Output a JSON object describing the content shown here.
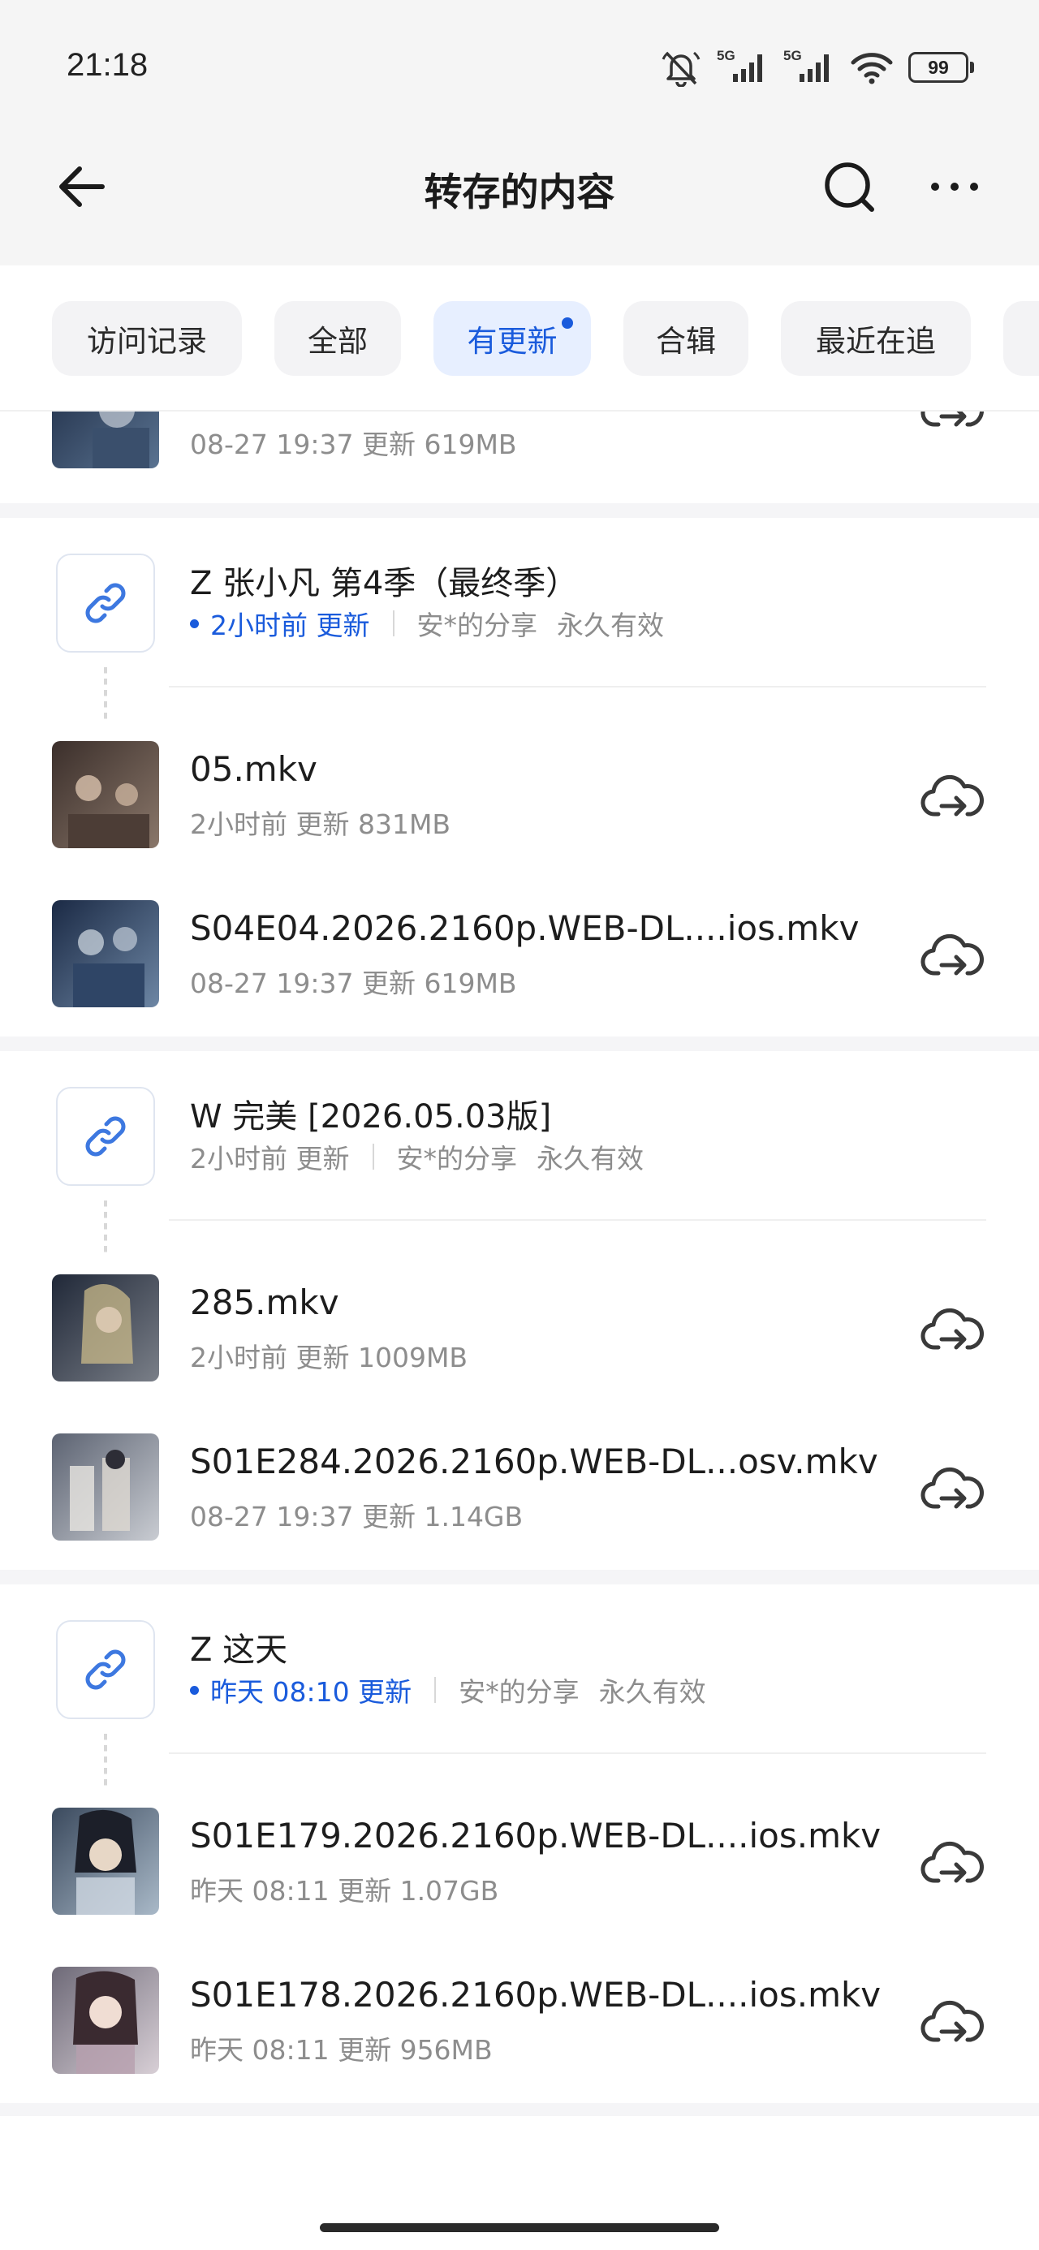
{
  "status_bar": {
    "time": "21:18",
    "net1": "5G",
    "net2": "5G",
    "battery": "99"
  },
  "nav": {
    "title": "转存的内容"
  },
  "tabs": [
    {
      "label": "访问记录",
      "active": false
    },
    {
      "label": "全部",
      "active": false
    },
    {
      "label": "有更新",
      "active": true,
      "dot": true
    },
    {
      "label": "合辑",
      "active": false
    },
    {
      "label": "最近在追",
      "active": false
    }
  ],
  "partial_row": {
    "meta": "08-27 19:37 更新 619MB"
  },
  "groups": [
    {
      "title": "Z  张小凡 第4季（最终季）",
      "update": "2小时前 更新",
      "update_highlight": true,
      "sharer": "安*的分享",
      "validity": "永久有效",
      "files": [
        {
          "name": "05.mkv",
          "meta": "2小时前 更新 831MB"
        },
        {
          "name": "S04E04.2026.2160p.WEB-DL....ios.mkv",
          "meta": "08-27 19:37 更新 619MB"
        }
      ]
    },
    {
      "title": "W 完美 [2026.05.03版]",
      "update": "2小时前 更新",
      "update_highlight": false,
      "sharer": "安*的分享",
      "validity": "永久有效",
      "files": [
        {
          "name": "285.mkv",
          "meta": "2小时前 更新 1009MB"
        },
        {
          "name": "S01E284.2026.2160p.WEB-DL...osv.mkv",
          "meta": "08-27 19:37 更新 1.14GB"
        }
      ]
    },
    {
      "title": "Z 这天",
      "update": "昨天 08:10 更新",
      "update_highlight": true,
      "sharer": "安*的分享",
      "validity": "永久有效",
      "files": [
        {
          "name": "S01E179.2026.2160p.WEB-DL....ios.mkv",
          "meta": "昨天 08:11 更新 1.07GB"
        },
        {
          "name": "S01E178.2026.2160p.WEB-DL....ios.mkv",
          "meta": "昨天 08:11 更新 956MB"
        }
      ]
    }
  ],
  "colors": {
    "accent": "#1a5bdc",
    "secondary_text": "#8d8d8d",
    "background_gray": "#f5f5f5"
  },
  "icons": [
    "mute-icon",
    "signal-icon",
    "wifi-icon",
    "battery-icon",
    "back-arrow-icon",
    "search-icon",
    "more-icon",
    "link-icon",
    "cloud-save-icon"
  ]
}
